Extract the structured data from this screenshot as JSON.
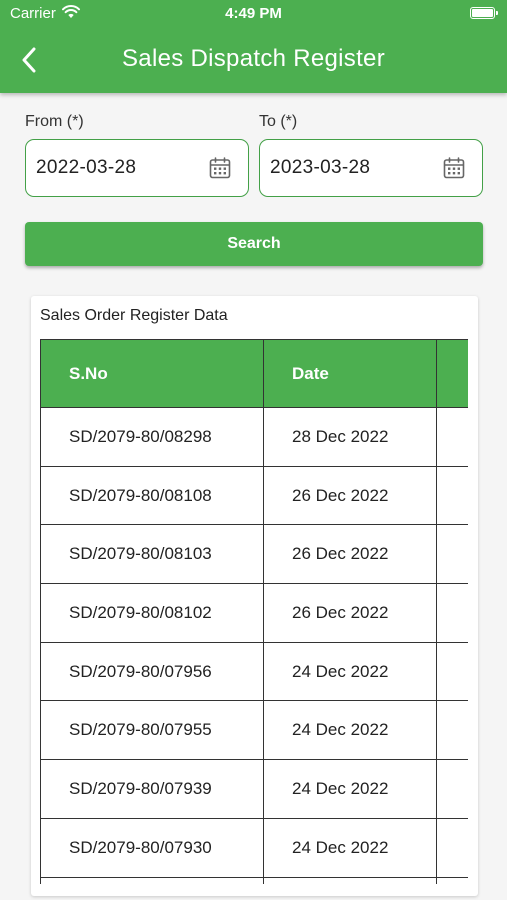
{
  "status_bar": {
    "carrier": "Carrier",
    "time": "4:49 PM"
  },
  "header": {
    "title": "Sales Dispatch Register"
  },
  "filters": {
    "from": {
      "label": "From (*)",
      "value": "2022-03-28"
    },
    "to": {
      "label": "To (*)",
      "value": "2023-03-28"
    },
    "search_label": "Search"
  },
  "card": {
    "title": "Sales Order Register Data",
    "columns": [
      "S.No",
      "Date",
      ""
    ],
    "rows": [
      {
        "sno": "SD/2079-80/08298",
        "date": "28 Dec 2022"
      },
      {
        "sno": "SD/2079-80/08108",
        "date": "26 Dec 2022"
      },
      {
        "sno": "SD/2079-80/08103",
        "date": "26 Dec 2022"
      },
      {
        "sno": "SD/2079-80/08102",
        "date": "26 Dec 2022"
      },
      {
        "sno": "SD/2079-80/07956",
        "date": "24 Dec 2022"
      },
      {
        "sno": "SD/2079-80/07955",
        "date": "24 Dec 2022"
      },
      {
        "sno": "SD/2079-80/07939",
        "date": "24 Dec 2022"
      },
      {
        "sno": "SD/2079-80/07930",
        "date": "24 Dec 2022"
      },
      {
        "sno": "",
        "date": ""
      }
    ]
  },
  "icons": {
    "back": "chevron-left-icon",
    "calendar": "calendar-icon",
    "wifi": "wifi-icon",
    "battery": "battery-icon"
  },
  "colors": {
    "primary": "#4caf50",
    "field_border": "#43a047",
    "background": "#f5f5f5"
  }
}
